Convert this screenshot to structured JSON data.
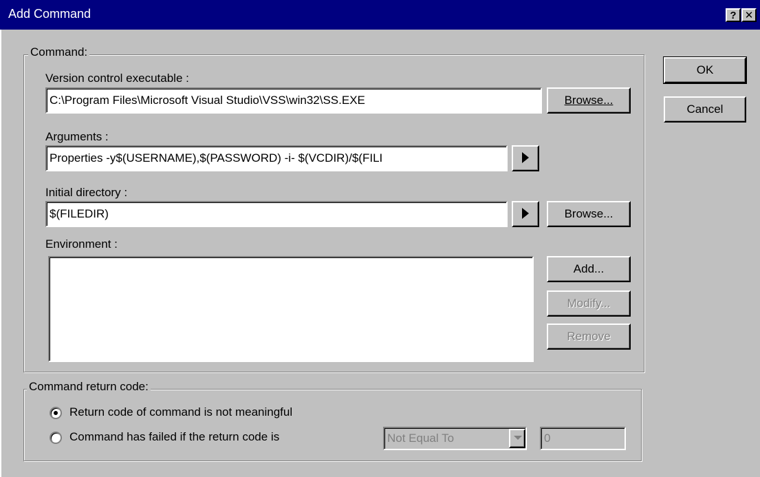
{
  "window": {
    "title": "Add Command",
    "help_glyph": "?",
    "close_glyph": "✕"
  },
  "command_group": {
    "legend": "Command:",
    "executable": {
      "label": "Version control executable :",
      "value": "C:\\Program Files\\Microsoft Visual Studio\\VSS\\win32\\SS.EXE",
      "browse_label": "Browse..."
    },
    "arguments": {
      "label": "Arguments :",
      "value": "Properties -y$(USERNAME),$(PASSWORD) -i- $(VCDIR)/$(FILI"
    },
    "initial_directory": {
      "label": "Initial directory :",
      "value": "$(FILEDIR)",
      "browse_label": "Browse..."
    },
    "environment": {
      "label": "Environment :",
      "add_label": "Add...",
      "modify_label": "Modify...",
      "remove_label": "Remove"
    }
  },
  "return_group": {
    "legend": "Command return code:",
    "option1": "Return code of command is not meaningful",
    "option2": "Command has failed if the return code is",
    "comparison": "Not Equal To",
    "code_value": "0"
  },
  "buttons": {
    "ok": "OK",
    "cancel": "Cancel"
  },
  "colors": {
    "titlebar": "#000080",
    "face": "#c0c0c0"
  },
  "icons": {
    "arguments_menu": "arrow-right-icon",
    "directory_menu": "arrow-right-icon",
    "dropdown": "chevron-down-icon",
    "radio_selected": "radio-dot-icon"
  }
}
